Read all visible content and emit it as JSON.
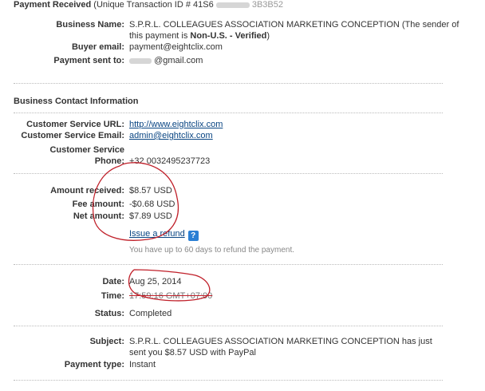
{
  "payment": {
    "heading": "Payment Received",
    "transaction_prefix": "(Unique Transaction ID # 41S6",
    "transaction_suffix": "3B3B52",
    "business_name_label": "Business Name:",
    "business_name_value": "S.P.R.L. COLLEAGUES ASSOCIATION MARKETING CONCEPTION (The sender of",
    "business_name_value2_prefix": "this payment is ",
    "business_name_value2_bold": "Non-U.S. - Verified",
    "business_name_value2_suffix": ")",
    "buyer_email_label": "Buyer email:",
    "buyer_email_value": "payment@eightclix.com",
    "sent_to_label": "Payment sent to:",
    "sent_to_value": "@gmail.com"
  },
  "contact": {
    "heading": "Business Contact Information",
    "url_label": "Customer Service URL:",
    "url_value": "http://www.eightclix.com",
    "email_label": "Customer Service Email:",
    "email_value": "admin@eightclix.com",
    "phone_label_1": "Customer Service",
    "phone_label_2": "Phone:",
    "phone_value": "+32 0032495237723"
  },
  "amounts": {
    "received_label": "Amount received:",
    "received_value": "$8.57 USD",
    "fee_label": "Fee amount:",
    "fee_value": "-$0.68 USD",
    "net_label": "Net amount:",
    "net_value": "$7.89 USD",
    "refund_link": "Issue a refund",
    "help_icon": "?",
    "refund_note": "You have up to 60 days to refund the payment."
  },
  "status": {
    "date_label": "Date:",
    "date_value": "Aug 25, 2014",
    "time_label": "Time:",
    "time_value": "17:59:16 GMT+07:00",
    "status_label": "Status:",
    "status_value": "Completed"
  },
  "details": {
    "subject_label": "Subject:",
    "subject_value_1": "S.P.R.L. COLLEAGUES ASSOCIATION MARKETING CONCEPTION has just",
    "subject_value_2": "sent you $8.57 USD with PayPal",
    "type_label": "Payment type:",
    "type_value": "Instant"
  },
  "colors": {
    "link": "#084482",
    "annotation": "#c0202a",
    "help_icon": "#2a7fd4"
  }
}
